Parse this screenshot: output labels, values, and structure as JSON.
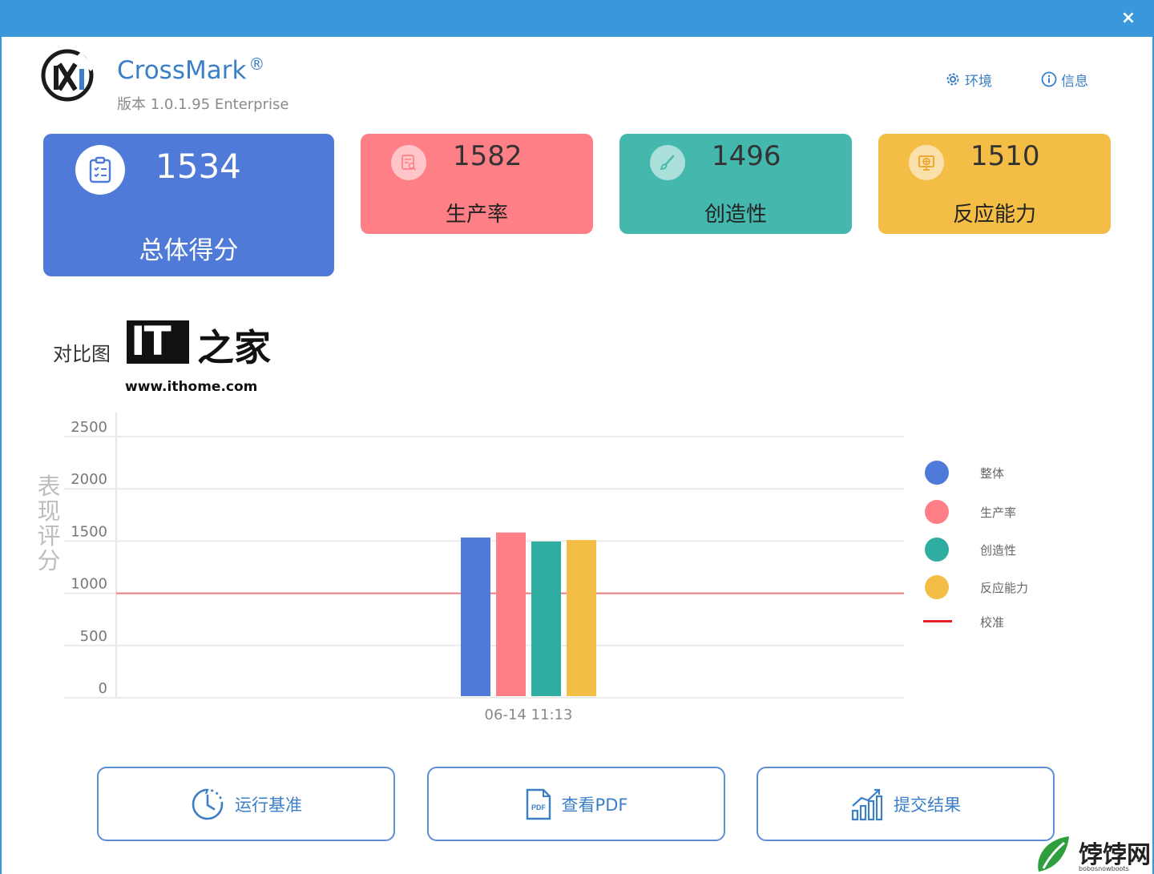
{
  "window": {
    "close_label": "×"
  },
  "app": {
    "name": "CrossMark",
    "registered": "®",
    "version": "版本 1.0.1.95 Enterprise",
    "logo_icon": "crossmark-logo-icon"
  },
  "header_links": [
    {
      "icon": "gear-icon",
      "label": "环境"
    },
    {
      "icon": "info-icon",
      "label": "信息"
    }
  ],
  "score_cards": {
    "overall": {
      "value": "1534",
      "label": "总体得分",
      "color": "#4f7ad8",
      "icon": "clipboard-icon"
    },
    "productivity": {
      "value": "1582",
      "label": "生产率",
      "color": "#ff7f86",
      "icon": "document-search-icon"
    },
    "creativity": {
      "value": "1496",
      "label": "创造性",
      "color": "#45b8ae",
      "icon": "brush-icon"
    },
    "responsiveness": {
      "value": "1510",
      "label": "反应能力",
      "color": "#f4bd45",
      "icon": "monitor-globe-icon"
    }
  },
  "comparison": {
    "title": "对比图",
    "y_axis_title": "表现评分"
  },
  "watermark": {
    "logo_text": "IT",
    "home_text": "之家",
    "url": "www.ithome.com"
  },
  "chart_data": {
    "type": "bar",
    "categories": [
      "06-14 11:13"
    ],
    "series": [
      {
        "name": "整体",
        "values": [
          1534
        ],
        "color": "#4f7ad8"
      },
      {
        "name": "生产率",
        "values": [
          1582
        ],
        "color": "#ff7f86"
      },
      {
        "name": "创造性",
        "values": [
          1496
        ],
        "color": "#2fada1"
      },
      {
        "name": "反应能力",
        "values": [
          1510
        ],
        "color": "#f4bd45"
      }
    ],
    "reference_line": {
      "name": "校准",
      "value": 1000,
      "color": "#e8202a"
    },
    "ylim": [
      0,
      2500
    ],
    "yticks": [
      "2500",
      "2000",
      "1500",
      "1000",
      "500",
      "0"
    ],
    "ylabel": "表现评分",
    "grid": true,
    "legend": "right"
  },
  "buttons": [
    {
      "icon": "clock-run-icon",
      "label": "运行基准"
    },
    {
      "icon": "pdf-icon",
      "label": "查看PDF"
    },
    {
      "icon": "chart-submit-icon",
      "label": "提交结果"
    }
  ],
  "site_brand": {
    "name": "饽饽网",
    "sub": "bobosnowboots"
  }
}
